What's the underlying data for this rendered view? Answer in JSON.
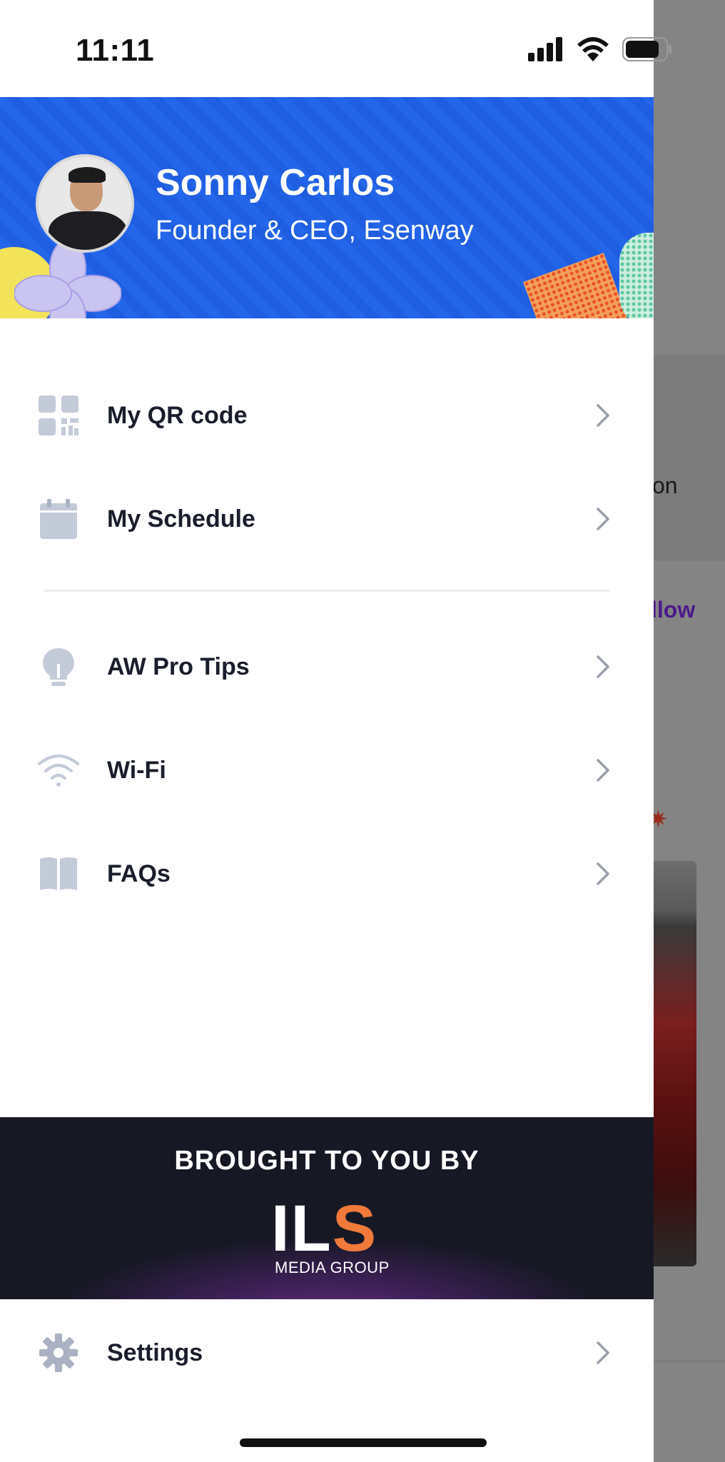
{
  "status_bar": {
    "time": "11:11"
  },
  "profile": {
    "name": "Sonny Carlos",
    "title": "Founder & CEO, Esenway"
  },
  "menu": {
    "items": [
      {
        "label": "My QR code",
        "icon": "qr-code-icon"
      },
      {
        "label": "My Schedule",
        "icon": "calendar-icon"
      },
      {
        "label": "AW Pro Tips",
        "icon": "lightbulb-icon"
      },
      {
        "label": "Wi-Fi",
        "icon": "wifi-icon"
      },
      {
        "label": "FAQs",
        "icon": "book-icon"
      }
    ]
  },
  "sponsor": {
    "heading": "BROUGHT TO YOU BY",
    "logo_main": "ILS",
    "logo_sub": "MEDIA GROUP"
  },
  "settings": {
    "label": "Settings",
    "icon": "gear-icon"
  },
  "background": {
    "text1": "on",
    "text2": "llow"
  },
  "colors": {
    "header_blue": "#1f5ee0",
    "icon_gray": "#c3cad8",
    "sponsor_dark": "#161824",
    "accent_orange": "#f07a3a"
  }
}
